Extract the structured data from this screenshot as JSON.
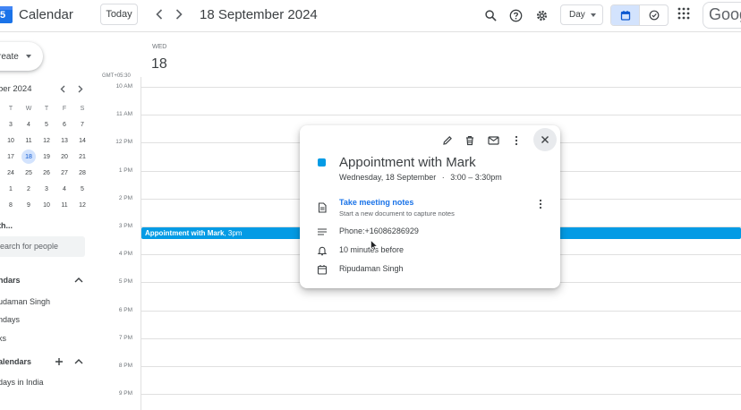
{
  "header": {
    "logo_number": "5",
    "app_title": "Calendar",
    "today_label": "Today",
    "date_title": "18 September 2024",
    "view_label": "Day",
    "brand_partial": "Goog"
  },
  "sidebar": {
    "create_label": "reate",
    "mini_cal": {
      "month": "ber 2024",
      "dow": [
        "T",
        "W",
        "T",
        "F",
        "S"
      ],
      "row0_first": "T",
      "rows": [
        [
          "",
          "3",
          "4",
          "5",
          "6",
          "7"
        ],
        [
          "",
          "10",
          "11",
          "12",
          "13",
          "14"
        ],
        [
          "",
          "17",
          "18",
          "19",
          "20",
          "21"
        ],
        [
          "",
          "24",
          "25",
          "26",
          "27",
          "28"
        ],
        [
          "",
          "1",
          "2",
          "3",
          "4",
          "5"
        ],
        [
          "",
          "8",
          "9",
          "10",
          "11",
          "12"
        ]
      ],
      "selected_day": "18"
    },
    "meet_label": "th...",
    "search_placeholder": "earch for people",
    "my_calendars_label": "ndars",
    "my_calendars": [
      "udaman Singh",
      "ndays",
      "ks"
    ],
    "other_calendars_label": "alendars",
    "other_calendars": [
      "days in India"
    ]
  },
  "day_view": {
    "weekday": "WED",
    "day_number": "18",
    "timezone": "GMT+05:30",
    "hours": [
      "10 AM",
      "11 AM",
      "12 PM",
      "1 PM",
      "2 PM",
      "3 PM",
      "4 PM",
      "5 PM",
      "6 PM",
      "7 PM",
      "8 PM",
      "9 PM"
    ],
    "event_title": "Appointment with Mark",
    "event_time": ", 3pm"
  },
  "event_popup": {
    "title": "Appointment with Mark",
    "date": "Wednesday, 18 September",
    "separator": "·",
    "time": "3:00 – 3:30pm",
    "notes_link": "Take meeting notes",
    "notes_sub": "Start a new document to capture notes",
    "description": "Phone:+16086286929",
    "reminder": "10 minutes before",
    "calendar_owner": "Ripudaman Singh",
    "event_color": "#039be5"
  },
  "colors": {
    "accent": "#1a73e8",
    "event": "#039be5",
    "selected_bg": "#d3e3fd"
  }
}
